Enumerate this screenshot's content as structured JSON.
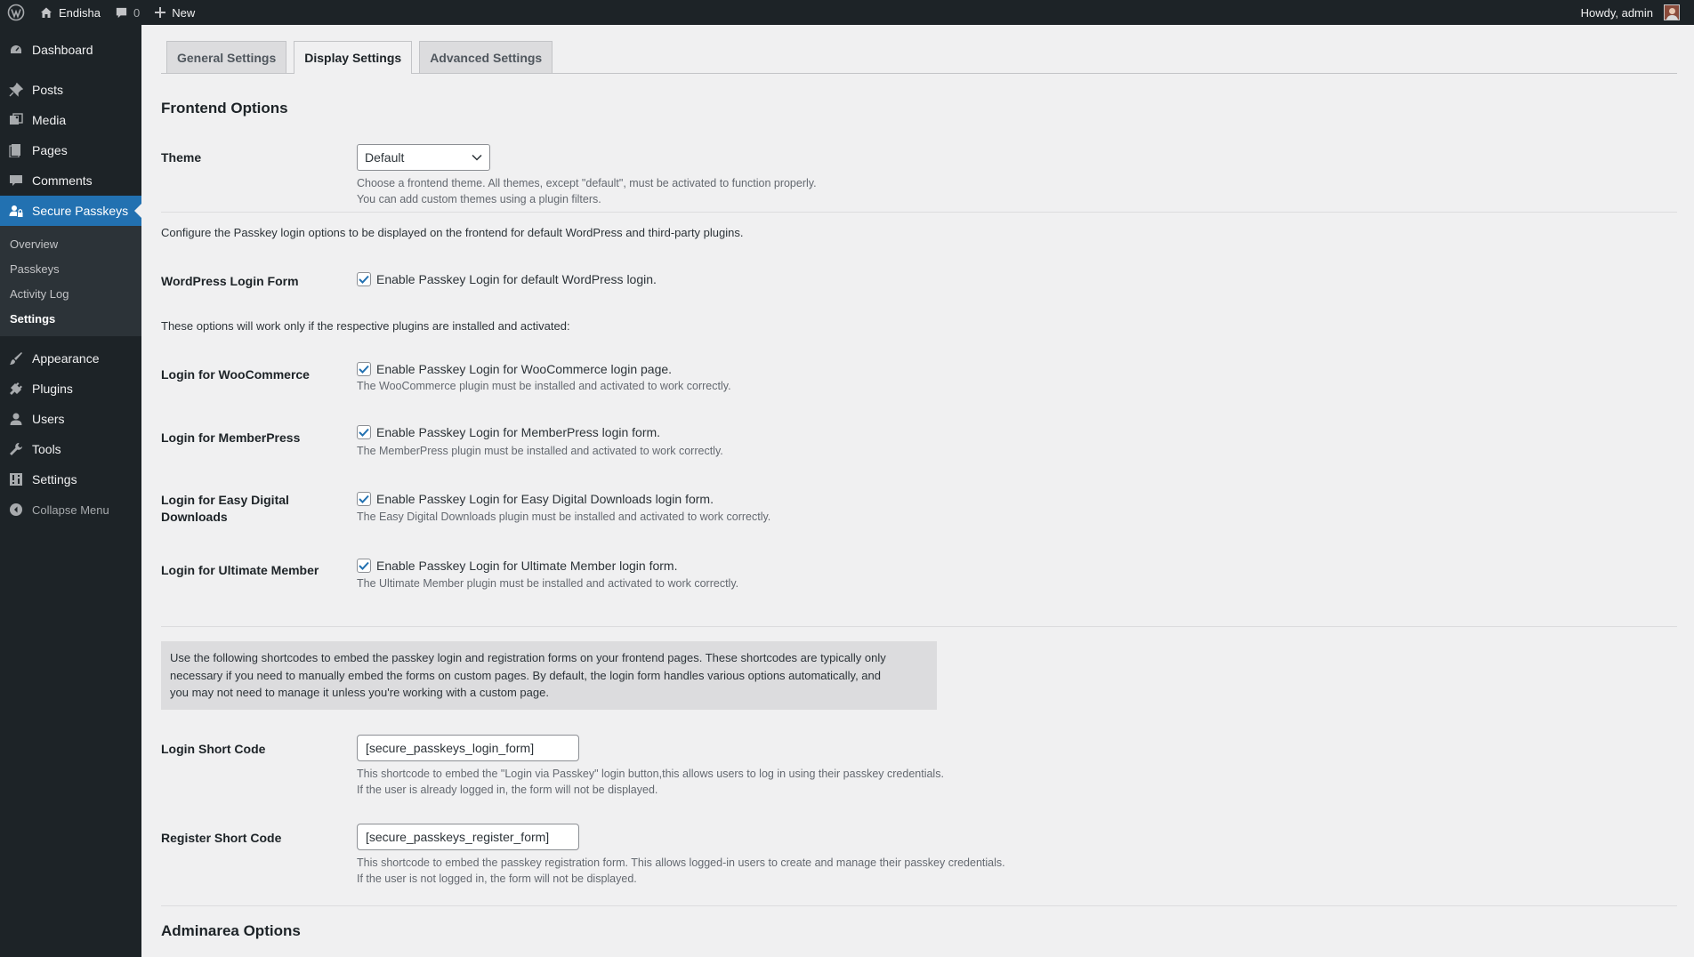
{
  "adminbar": {
    "site_name": "Endisha",
    "comments_count": "0",
    "new_label": "New",
    "howdy": "Howdy, admin"
  },
  "sidebar": {
    "items_top": [
      {
        "label": "Dashboard",
        "icon": "dashboard-icon"
      },
      {
        "label": "Posts",
        "icon": "pin-icon"
      },
      {
        "label": "Media",
        "icon": "media-icon"
      },
      {
        "label": "Pages",
        "icon": "page-icon"
      },
      {
        "label": "Comments",
        "icon": "comment-icon"
      },
      {
        "label": "Secure Passkeys",
        "icon": "user-lock-icon"
      }
    ],
    "submenu": [
      "Overview",
      "Passkeys",
      "Activity Log",
      "Settings"
    ],
    "items_bottom": [
      {
        "label": "Appearance",
        "icon": "brush-icon"
      },
      {
        "label": "Plugins",
        "icon": "plug-icon"
      },
      {
        "label": "Users",
        "icon": "user-icon"
      },
      {
        "label": "Tools",
        "icon": "wrench-icon"
      },
      {
        "label": "Settings",
        "icon": "settings-icon"
      }
    ],
    "collapse_label": "Collapse Menu"
  },
  "tabs": [
    "General Settings",
    "Display Settings",
    "Advanced Settings"
  ],
  "frontend": {
    "heading": "Frontend Options",
    "theme_label": "Theme",
    "theme_value": "Default",
    "theme_desc1": "Choose a frontend theme. All themes, except \"default\", must be activated to function properly.",
    "theme_desc2": "You can add custom themes using a plugin filters.",
    "configure_text": "Configure the Passkey login options to be displayed on the frontend for default WordPress and third-party plugins.",
    "wp_label": "WordPress Login Form",
    "wp_check": "Enable Passkey Login for default WordPress login.",
    "plugins_note": "These options will work only if the respective plugins are installed and activated:",
    "woo_label": "Login for WooCommerce",
    "woo_check": "Enable Passkey Login for WooCommerce login page.",
    "woo_desc": "The WooCommerce plugin must be installed and activated to work correctly.",
    "mp_label": "Login for MemberPress",
    "mp_check": "Enable Passkey Login for MemberPress login form.",
    "mp_desc": "The MemberPress plugin must be installed and activated to work correctly.",
    "edd_label_1": "Login for Easy Digital",
    "edd_label_2": "Downloads",
    "edd_check": "Enable Passkey Login for Easy Digital Downloads login form.",
    "edd_desc": "The Easy Digital Downloads plugin must be installed and activated to work correctly.",
    "um_label": "Login for Ultimate Member",
    "um_check": "Enable Passkey Login for Ultimate Member login form.",
    "um_desc": "The Ultimate Member plugin must be installed and activated to work correctly.",
    "notice_1": "Use the following shortcodes to embed the passkey login and registration forms on your frontend pages. These shortcodes are typically only",
    "notice_2": "necessary if you need to manually embed the forms on custom pages. By default, the login form handles various options automatically, and",
    "notice_3": "you may not need to manage it unless you're working with a custom page.",
    "login_sc_label": "Login Short Code",
    "login_sc_value": "[secure_passkeys_login_form]",
    "login_sc_desc1": "This shortcode to embed the \"Login via Passkey\" login button,this allows users to log in using their passkey credentials.",
    "login_sc_desc2": "If the user is already logged in, the form will not be displayed.",
    "reg_sc_label": "Register Short Code",
    "reg_sc_value": "[secure_passkeys_register_form]",
    "reg_sc_desc1": "This shortcode to embed the passkey registration form. This allows logged-in users to create and manage their passkey credentials.",
    "reg_sc_desc2": "If the user is not logged in, the form will not be displayed."
  },
  "adminarea": {
    "heading": "Adminarea Options"
  },
  "colors": {
    "accent": "#2271b1",
    "bar": "#1d2327"
  }
}
